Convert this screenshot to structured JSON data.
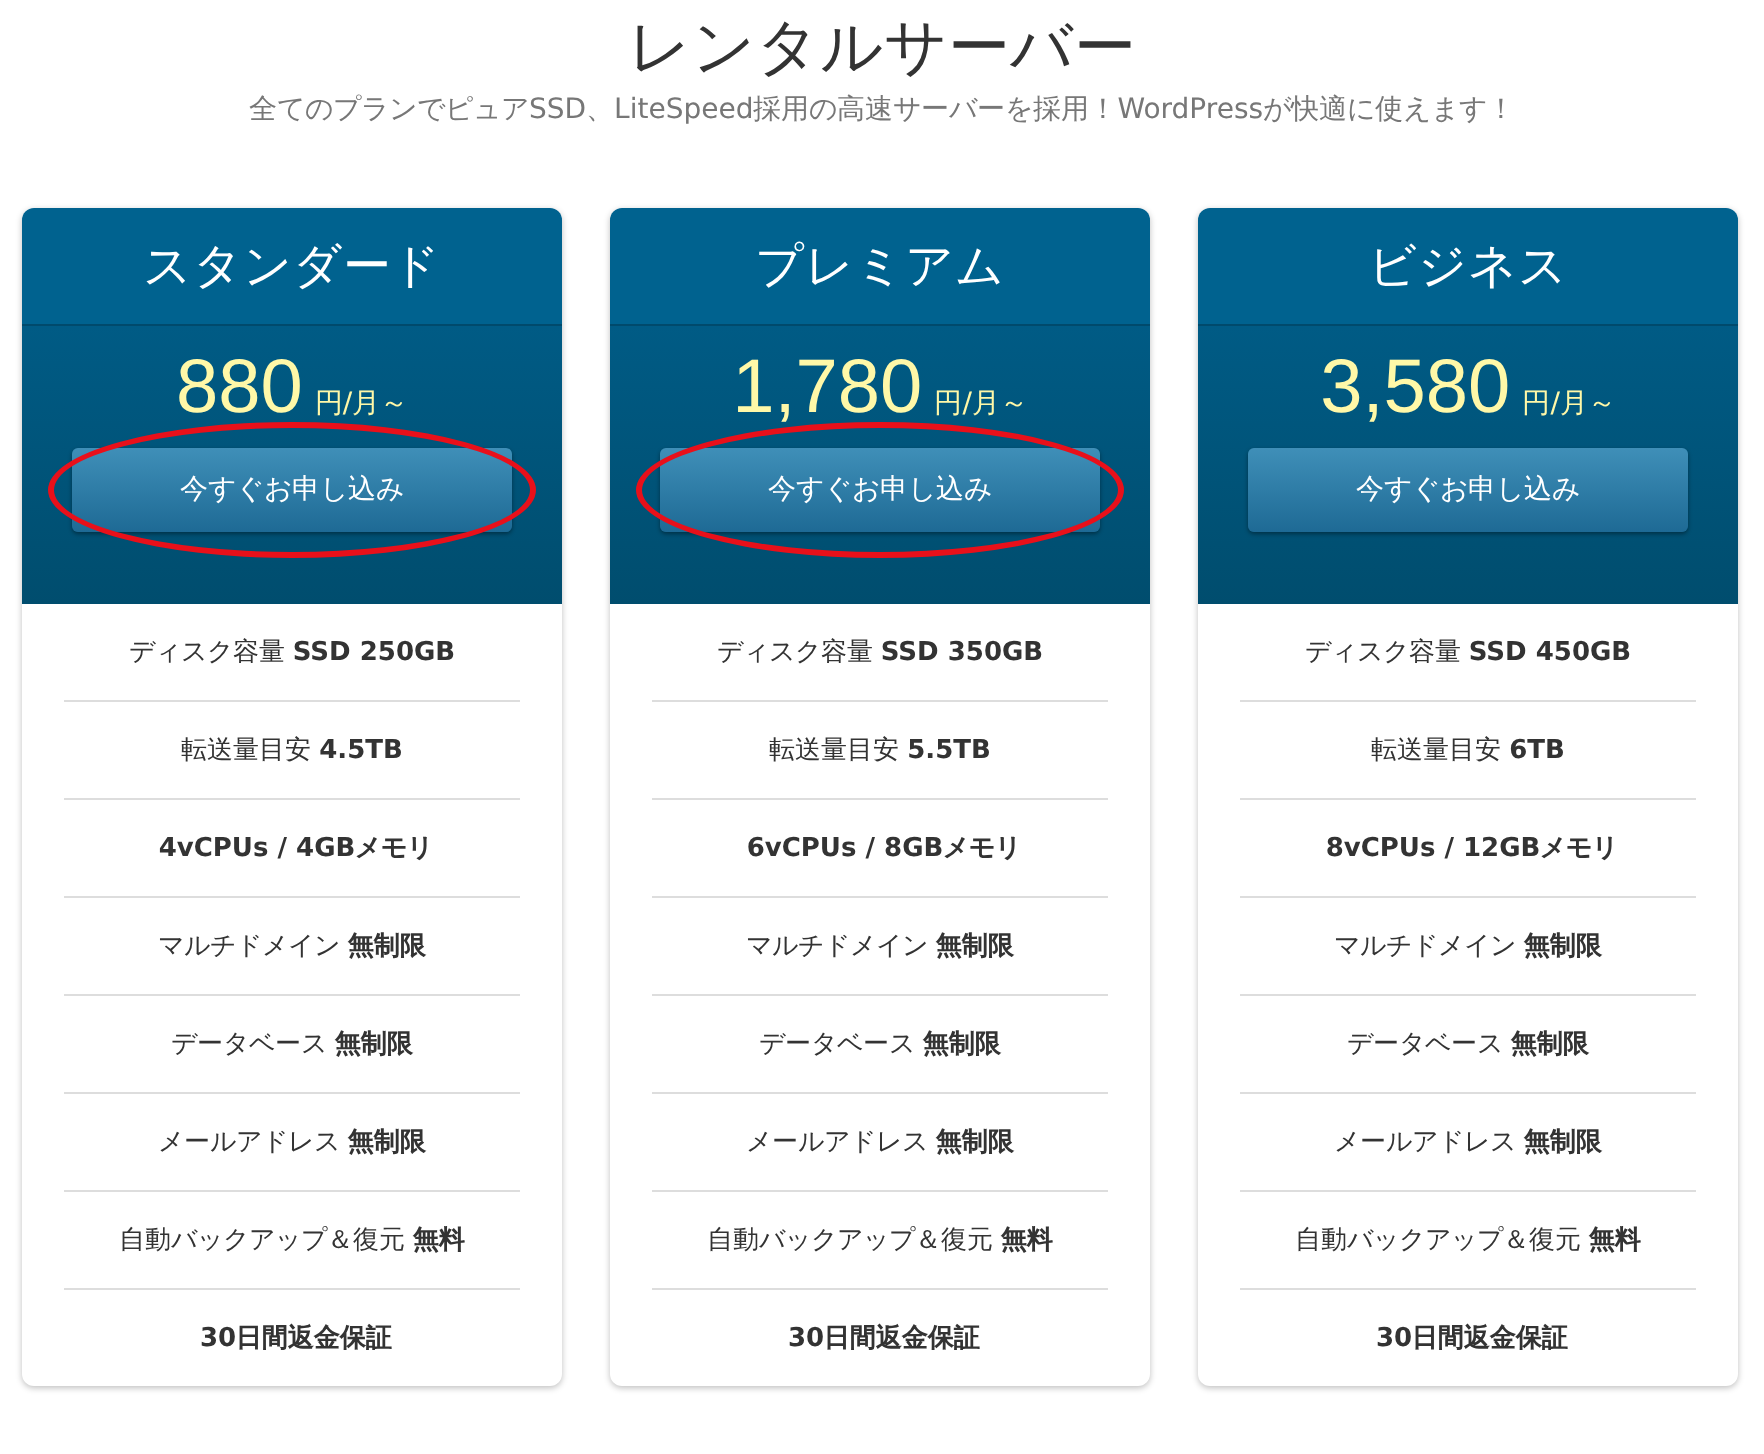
{
  "page": {
    "title": "レンタルサーバー",
    "subtitle": "全てのプランでピュアSSD、LiteSpeed採用の高速サーバーを採用！WordPressが快適に使えます！"
  },
  "plans": [
    {
      "name": "スタンダード",
      "price": "880",
      "unit": "円/月～",
      "button": "今すぐお申し込み",
      "highlighted": true,
      "features": [
        "ディスク容量 **SSD 250GB**",
        "転送量目安 **4.5TB**",
        "**4vCPUs / 4GBメモリ**",
        "マルチドメイン **無制限**",
        "データベース **無制限**",
        "メールアドレス **無制限**",
        "自動バックアップ＆復元 **無料**",
        "**30日間返金保証**"
      ]
    },
    {
      "name": "プレミアム",
      "price": "1,780",
      "unit": "円/月～",
      "button": "今すぐお申し込み",
      "highlighted": true,
      "features": [
        "ディスク容量 **SSD 350GB**",
        "転送量目安 **5.5TB**",
        "**6vCPUs / 8GBメモリ**",
        "マルチドメイン **無制限**",
        "データベース **無制限**",
        "メールアドレス **無制限**",
        "自動バックアップ＆復元 **無料**",
        "**30日間返金保証**"
      ]
    },
    {
      "name": "ビジネス",
      "price": "3,580",
      "unit": "円/月～",
      "button": "今すぐお申し込み",
      "highlighted": false,
      "features": [
        "ディスク容量 **SSD 450GB**",
        "転送量目安 **6TB**",
        "**8vCPUs / 12GBメモリ**",
        "マルチドメイン **無制限**",
        "データベース **無制限**",
        "メールアドレス **無制限**",
        "自動バックアップ＆復元 **無料**",
        "**30日間返金保証**"
      ]
    }
  ]
}
